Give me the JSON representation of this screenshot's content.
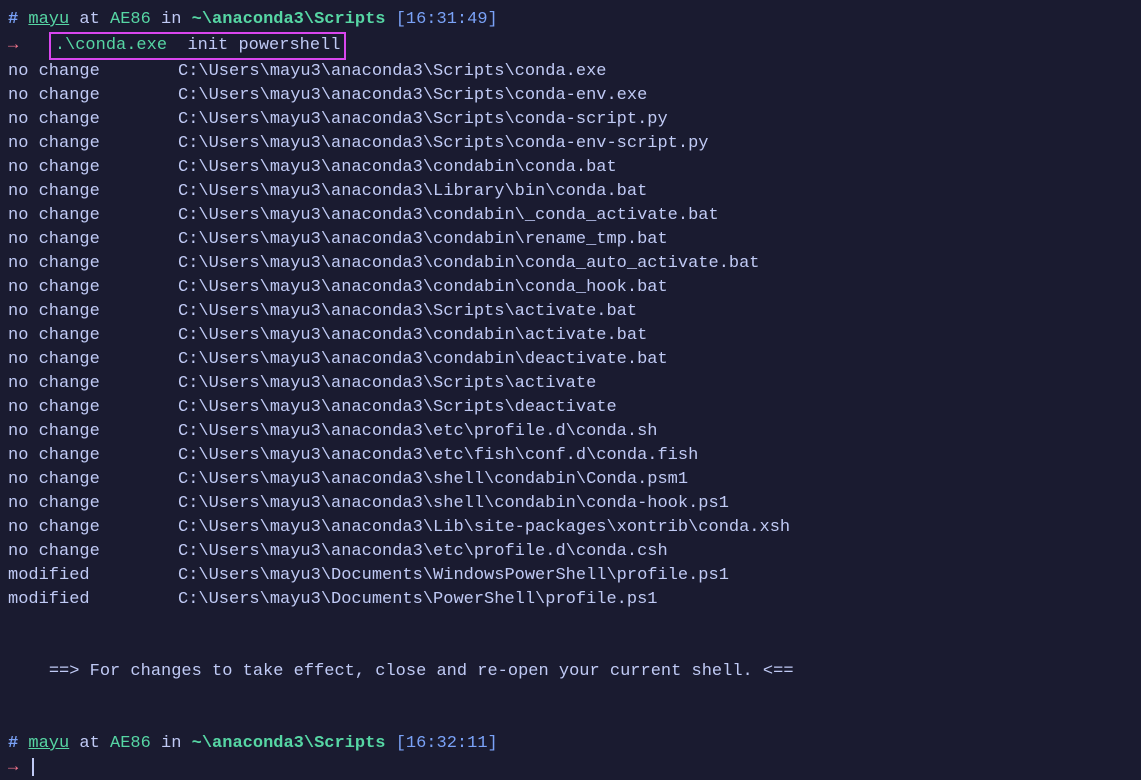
{
  "prompt1": {
    "hash": "#",
    "user": "mayu",
    "at": "at",
    "host": "AE86",
    "in": "in",
    "path": "~\\anaconda3\\Scripts",
    "time": "[16:31:49]",
    "arrow": "→",
    "cmd_exec": ".\\conda.exe",
    "cmd_args": "init powershell"
  },
  "lines": [
    {
      "status": "no change",
      "path": "C:\\Users\\mayu3\\anaconda3\\Scripts\\conda.exe"
    },
    {
      "status": "no change",
      "path": "C:\\Users\\mayu3\\anaconda3\\Scripts\\conda-env.exe"
    },
    {
      "status": "no change",
      "path": "C:\\Users\\mayu3\\anaconda3\\Scripts\\conda-script.py"
    },
    {
      "status": "no change",
      "path": "C:\\Users\\mayu3\\anaconda3\\Scripts\\conda-env-script.py"
    },
    {
      "status": "no change",
      "path": "C:\\Users\\mayu3\\anaconda3\\condabin\\conda.bat"
    },
    {
      "status": "no change",
      "path": "C:\\Users\\mayu3\\anaconda3\\Library\\bin\\conda.bat"
    },
    {
      "status": "no change",
      "path": "C:\\Users\\mayu3\\anaconda3\\condabin\\_conda_activate.bat"
    },
    {
      "status": "no change",
      "path": "C:\\Users\\mayu3\\anaconda3\\condabin\\rename_tmp.bat"
    },
    {
      "status": "no change",
      "path": "C:\\Users\\mayu3\\anaconda3\\condabin\\conda_auto_activate.bat"
    },
    {
      "status": "no change",
      "path": "C:\\Users\\mayu3\\anaconda3\\condabin\\conda_hook.bat"
    },
    {
      "status": "no change",
      "path": "C:\\Users\\mayu3\\anaconda3\\Scripts\\activate.bat"
    },
    {
      "status": "no change",
      "path": "C:\\Users\\mayu3\\anaconda3\\condabin\\activate.bat"
    },
    {
      "status": "no change",
      "path": "C:\\Users\\mayu3\\anaconda3\\condabin\\deactivate.bat"
    },
    {
      "status": "no change",
      "path": "C:\\Users\\mayu3\\anaconda3\\Scripts\\activate"
    },
    {
      "status": "no change",
      "path": "C:\\Users\\mayu3\\anaconda3\\Scripts\\deactivate"
    },
    {
      "status": "no change",
      "path": "C:\\Users\\mayu3\\anaconda3\\etc\\profile.d\\conda.sh"
    },
    {
      "status": "no change",
      "path": "C:\\Users\\mayu3\\anaconda3\\etc\\fish\\conf.d\\conda.fish"
    },
    {
      "status": "no change",
      "path": "C:\\Users\\mayu3\\anaconda3\\shell\\condabin\\Conda.psm1"
    },
    {
      "status": "no change",
      "path": "C:\\Users\\mayu3\\anaconda3\\shell\\condabin\\conda-hook.ps1"
    },
    {
      "status": "no change",
      "path": "C:\\Users\\mayu3\\anaconda3\\Lib\\site-packages\\xontrib\\conda.xsh"
    },
    {
      "status": "no change",
      "path": "C:\\Users\\mayu3\\anaconda3\\etc\\profile.d\\conda.csh"
    },
    {
      "status": "modified",
      "path": "C:\\Users\\mayu3\\Documents\\WindowsPowerShell\\profile.ps1"
    },
    {
      "status": "modified",
      "path": "C:\\Users\\mayu3\\Documents\\PowerShell\\profile.ps1"
    }
  ],
  "message": "==> For changes to take effect, close and re-open your current shell. <==",
  "prompt2": {
    "hash": "#",
    "user": "mayu",
    "at": "at",
    "host": "AE86",
    "in": "in",
    "path": "~\\anaconda3\\Scripts",
    "time": "[16:32:11]",
    "arrow": "→"
  }
}
